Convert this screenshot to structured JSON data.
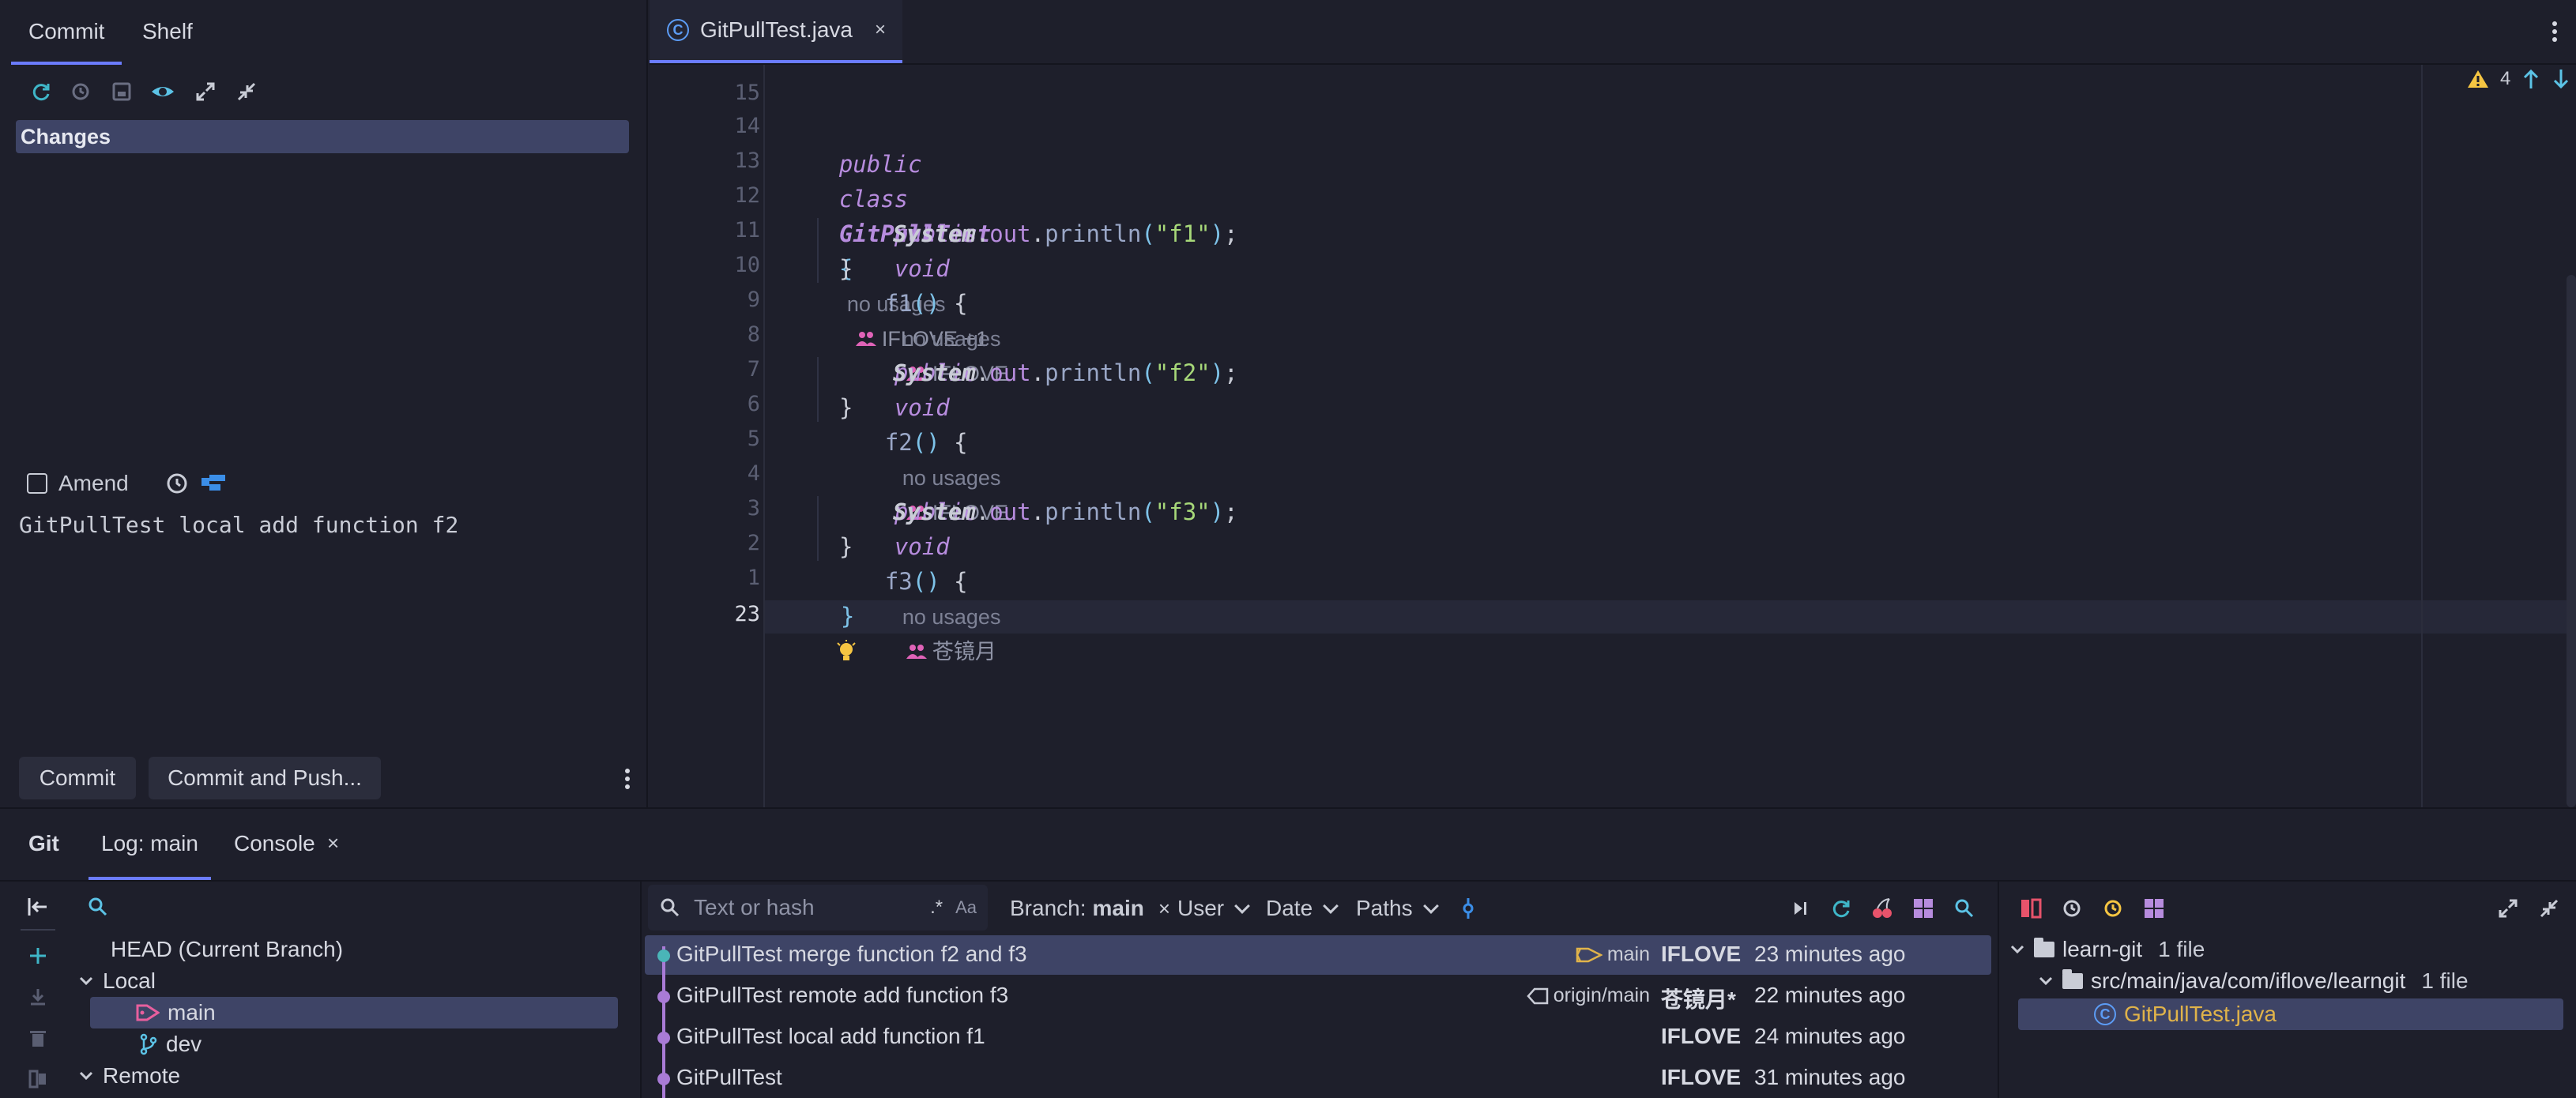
{
  "colors": {
    "accent": "#6b7cff",
    "selection": "#3e4466",
    "keyword": "#b78cde",
    "string": "#a7d879",
    "warning": "#f5c542",
    "tag": "#e85f9e",
    "graph": "#a97bd6",
    "file_modified": "#e0b34a",
    "refresh": "#3fb6c8"
  },
  "commit_panel": {
    "tabs": [
      "Commit",
      "Shelf"
    ],
    "toolbar_icons": [
      "refresh-icon",
      "rollback-icon",
      "shelve-icon",
      "eye-icon",
      "expand-icon",
      "collapse-icon"
    ],
    "changes_label": "Changes",
    "amend_label": "Amend",
    "message": "GitPullTest local add function f2",
    "commit_button": "Commit",
    "commit_push_button": "Commit and Push..."
  },
  "editor": {
    "tab_title": "GitPullTest.java",
    "tab_close": "×",
    "warnings_count": "4",
    "line_numbers": [
      "15",
      "14",
      "13",
      "12",
      "11",
      "10",
      "9",
      "8",
      "7",
      "6",
      "5",
      "4",
      "3",
      "2",
      "1",
      "23"
    ],
    "hints": {
      "no_usages": "no usages",
      "class_author": "IFLOVE +1",
      "f1_author": "IFLOVE",
      "f2_author": "IFLOVE",
      "f3_author": "苍镜月"
    },
    "code": {
      "kw_public": "public",
      "kw_class": "class",
      "kw_void": "void",
      "class_name": "GitPullTest",
      "f1": "f1",
      "f2": "f2",
      "f3": "f3",
      "system": "System",
      "out": "out",
      "println": "println",
      "s1": "\"f1\"",
      "s2": "\"f2\"",
      "s3": "\"f3\""
    }
  },
  "git_window": {
    "title": "Git",
    "tabs": [
      "Log: main",
      "Console"
    ],
    "console_close": "×",
    "branches": {
      "head": "HEAD (Current Branch)",
      "local": "Local",
      "main": "main",
      "dev": "dev",
      "remote": "Remote"
    },
    "log": {
      "search_placeholder": "Text or hash",
      "regex_icon": ".*",
      "case_icon": "Aa",
      "branch_filter_label": "Branch:",
      "branch_filter_value": "main",
      "branch_filter_close": "×",
      "user_filter": "User",
      "date_filter": "Date",
      "paths_filter": "Paths",
      "commits": [
        {
          "subject": "GitPullTest merge function f2 and f3",
          "ref": "main",
          "author": "IFLOVE",
          "date": "23 minutes ago"
        },
        {
          "subject": "GitPullTest remote add function f3",
          "ref": "origin/main",
          "author": "苍镜月*",
          "date": "22 minutes ago"
        },
        {
          "subject": "GitPullTest local add function f1",
          "ref": "",
          "author": "IFLOVE",
          "date": "24 minutes ago"
        },
        {
          "subject": "GitPullTest",
          "ref": "",
          "author": "IFLOVE",
          "date": "31 minutes ago"
        }
      ]
    },
    "changes_tree": {
      "root": "learn-git",
      "root_count": "1 file",
      "folder": "src/main/java/com/iflove/learngit",
      "folder_count": "1 file",
      "file": "GitPullTest.java"
    }
  }
}
